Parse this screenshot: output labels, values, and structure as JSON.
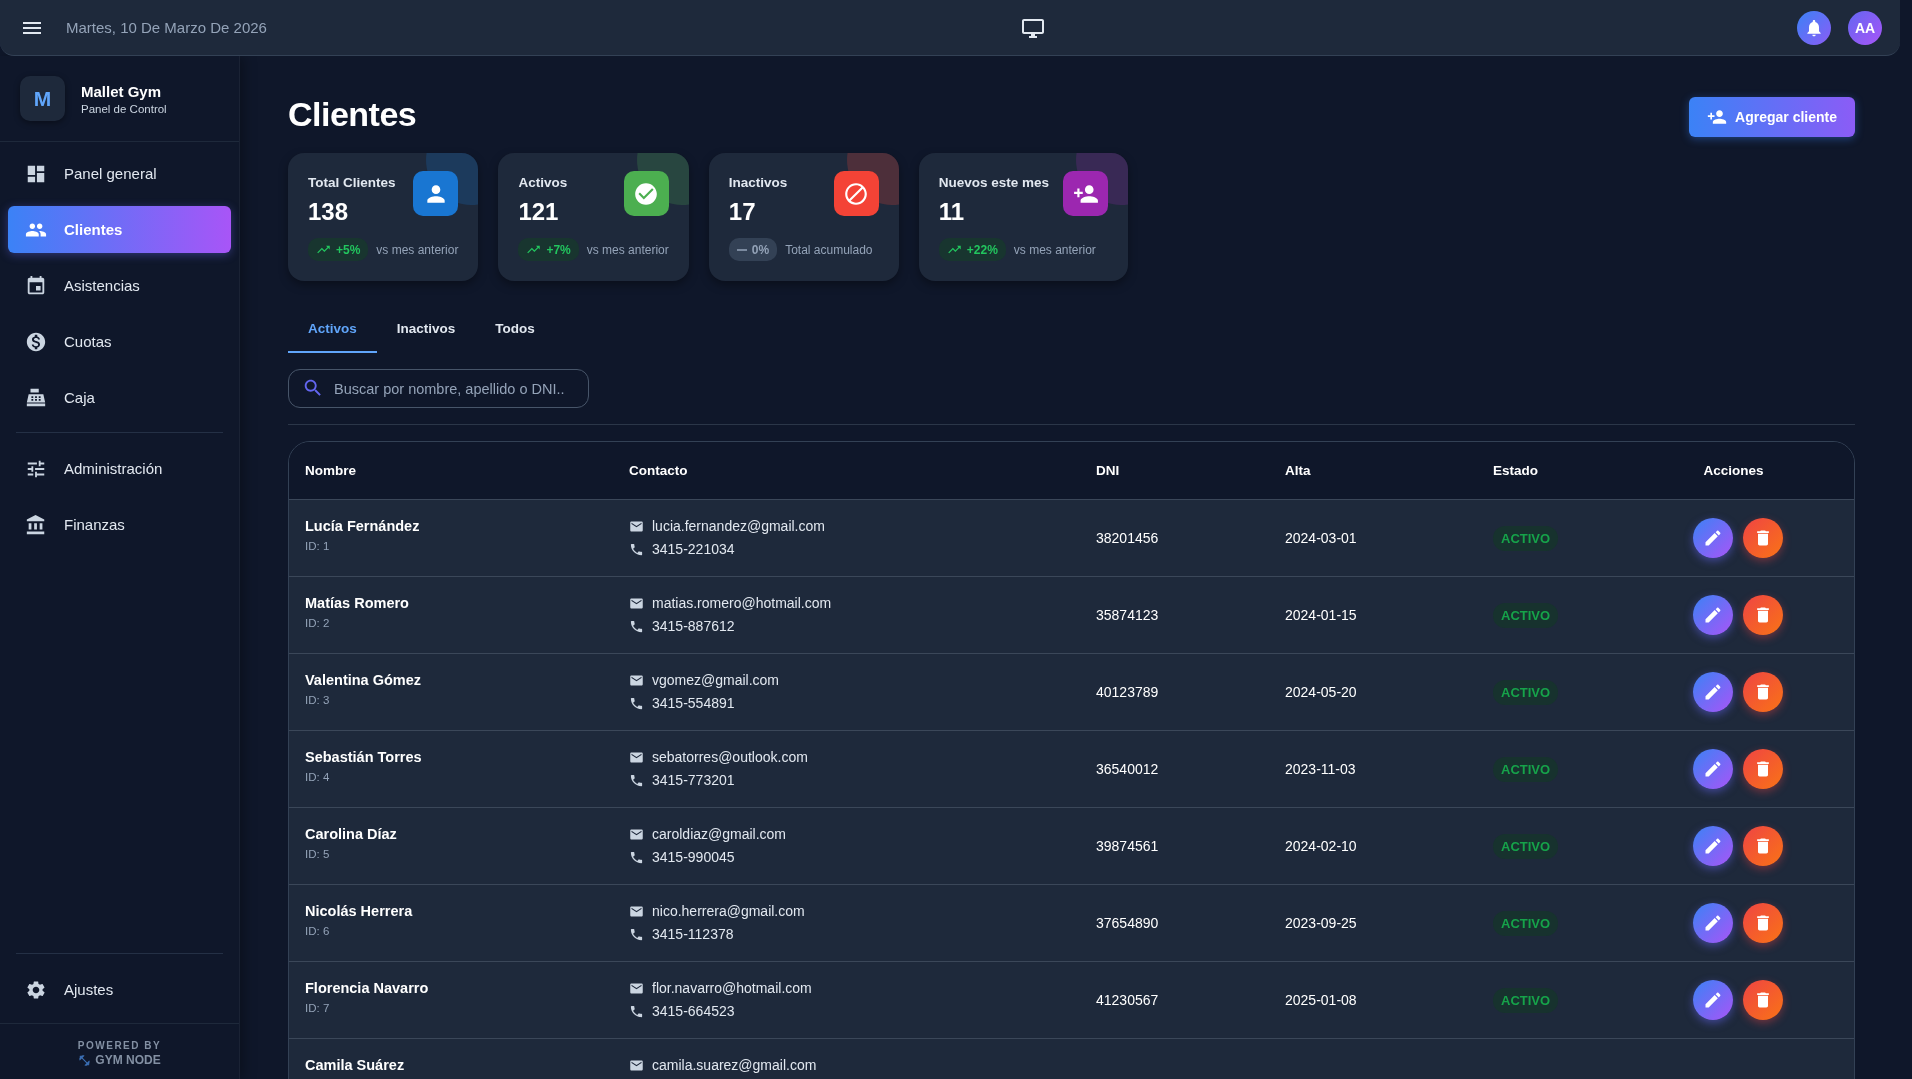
{
  "topbar": {
    "date": "Martes, 10 De Marzo De 2026",
    "avatar": "AA"
  },
  "sidebar": {
    "brand": {
      "logo": "M",
      "name": "Mallet Gym",
      "subtitle": "Panel de Control"
    },
    "main_items": [
      {
        "label": "Panel general",
        "selected": false
      },
      {
        "label": "Clientes",
        "selected": true
      },
      {
        "label": "Asistencias",
        "selected": false
      },
      {
        "label": "Cuotas",
        "selected": false
      },
      {
        "label": "Caja",
        "selected": false
      }
    ],
    "admin_items": [
      {
        "label": "Administración",
        "selected": false
      },
      {
        "label": "Finanzas",
        "selected": false
      }
    ],
    "settings_item": {
      "label": "Ajustes",
      "selected": false
    },
    "footer": {
      "powered": "POWERED BY",
      "product": "GYM NODE"
    }
  },
  "page": {
    "title": "Clientes",
    "add_button": "Agregar cliente"
  },
  "stats": [
    {
      "label": "Total Clientes",
      "value": "138",
      "change": "+5%",
      "kind": "up",
      "note": "vs mes anterior",
      "color": "#1976d2"
    },
    {
      "label": "Activos",
      "value": "121",
      "change": "+7%",
      "kind": "up",
      "note": "vs mes anterior",
      "color": "#4caf50"
    },
    {
      "label": "Inactivos",
      "value": "17",
      "change": "0%",
      "kind": "flat",
      "note": "Total acumulado",
      "color": "#f44336"
    },
    {
      "label": "Nuevos este mes",
      "value": "11",
      "change": "+22%",
      "kind": "up",
      "note": "vs mes anterior",
      "color": "#9c27b0"
    }
  ],
  "tabs": [
    {
      "label": "Activos",
      "selected": true
    },
    {
      "label": "Inactivos",
      "selected": false
    },
    {
      "label": "Todos",
      "selected": false
    }
  ],
  "search": {
    "placeholder": "Buscar por nombre, apellido o DNI.."
  },
  "table": {
    "columns": [
      "Nombre",
      "Contacto",
      "DNI",
      "Alta",
      "Estado",
      "Acciones"
    ],
    "rows": [
      {
        "name": "Lucía Fernández",
        "id": "ID: 1",
        "email": "lucia.fernandez@gmail.com",
        "phone": "3415-221034",
        "dni": "38201456",
        "alta": "2024-03-01",
        "status": "ACTIVO",
        "kind": "active"
      },
      {
        "name": "Matías Romero",
        "id": "ID: 2",
        "email": "matias.romero@hotmail.com",
        "phone": "3415-887612",
        "dni": "35874123",
        "alta": "2024-01-15",
        "status": "ACTIVO",
        "kind": "active"
      },
      {
        "name": "Valentina Gómez",
        "id": "ID: 3",
        "email": "vgomez@gmail.com",
        "phone": "3415-554891",
        "dni": "40123789",
        "alta": "2024-05-20",
        "status": "ACTIVO",
        "kind": "active"
      },
      {
        "name": "Sebastián Torres",
        "id": "ID: 4",
        "email": "sebatorres@outlook.com",
        "phone": "3415-773201",
        "dni": "36540012",
        "alta": "2023-11-03",
        "status": "ACTIVO",
        "kind": "active"
      },
      {
        "name": "Carolina Díaz",
        "id": "ID: 5",
        "email": "caroldiaz@gmail.com",
        "phone": "3415-990045",
        "dni": "39874561",
        "alta": "2024-02-10",
        "status": "ACTIVO",
        "kind": "active"
      },
      {
        "name": "Nicolás Herrera",
        "id": "ID: 6",
        "email": "nico.herrera@gmail.com",
        "phone": "3415-112378",
        "dni": "37654890",
        "alta": "2023-09-25",
        "status": "ACTIVO",
        "kind": "active"
      },
      {
        "name": "Florencia Navarro",
        "id": "ID: 7",
        "email": "flor.navarro@hotmail.com",
        "phone": "3415-664523",
        "dni": "41230567",
        "alta": "2025-01-08",
        "status": "ACTIVO",
        "kind": "active"
      },
      {
        "name": "Camila Suárez",
        "email": "camila.suarez@gmail.com"
      }
    ]
  }
}
